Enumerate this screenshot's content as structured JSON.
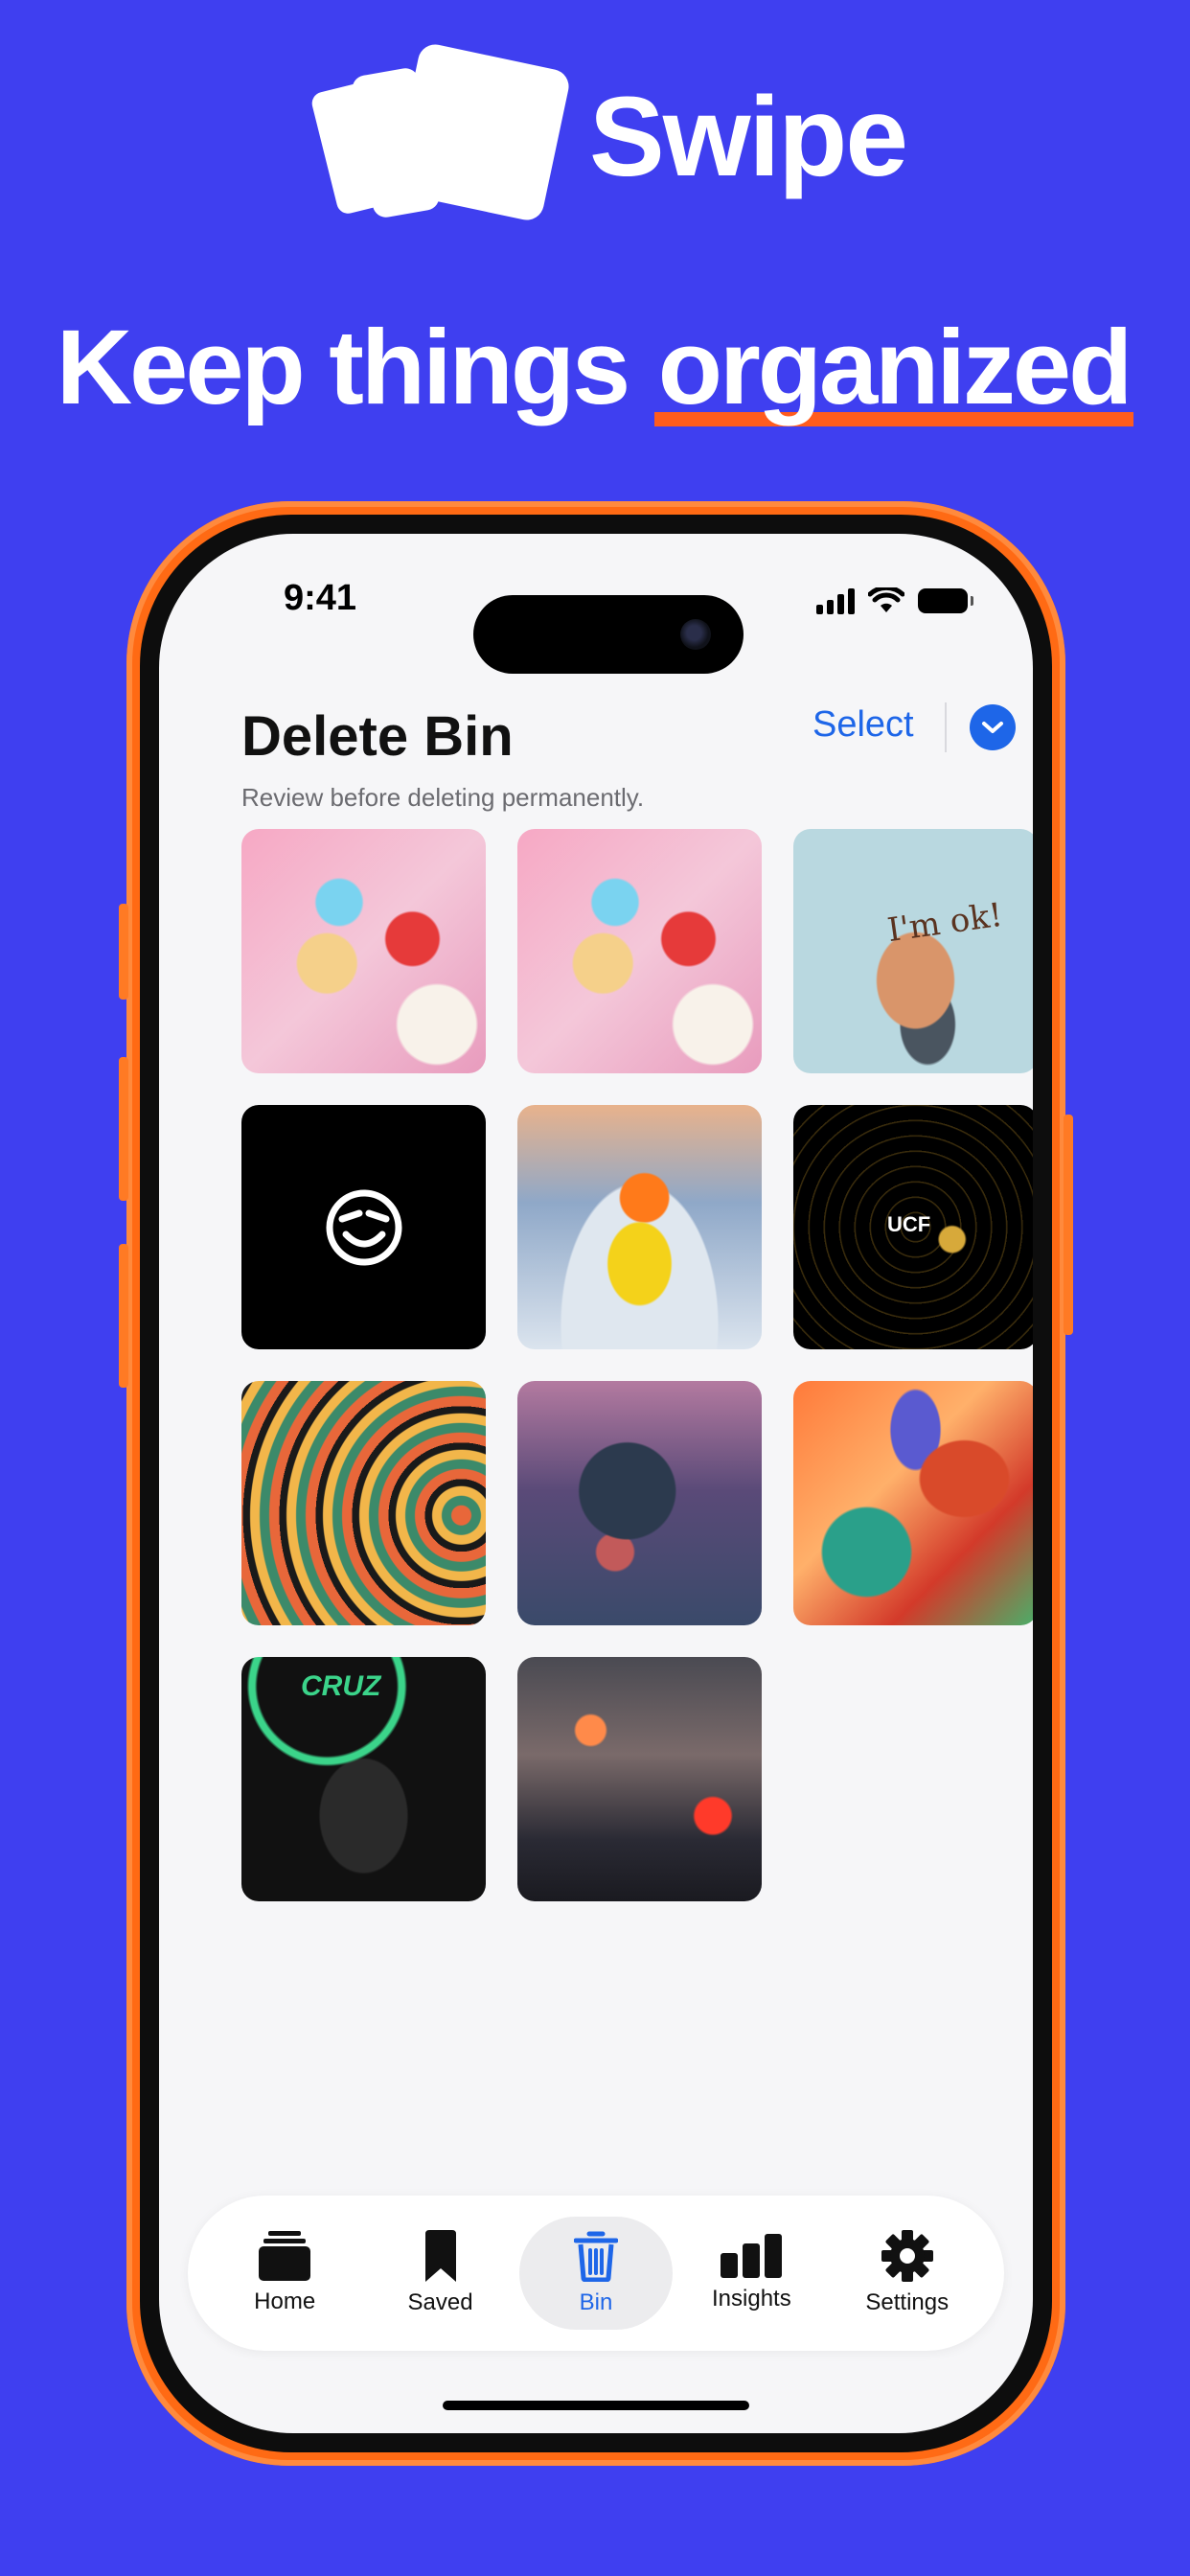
{
  "brand": {
    "name": "Swipe"
  },
  "headline": {
    "lead": "Keep things ",
    "highlight": "organized"
  },
  "status_bar": {
    "time": "9:41"
  },
  "screen": {
    "title": "Delete Bin",
    "subtitle": "Review before deleting permanently.",
    "select_label": "Select"
  },
  "thumbnails_text": {
    "cat_caption": "I'm ok!",
    "space_badge": "UCF",
    "cruz_text": "CRUZ"
  },
  "tabs": [
    {
      "label": "Home",
      "icon": "stack-icon"
    },
    {
      "label": "Saved",
      "icon": "bookmark-icon"
    },
    {
      "label": "Bin",
      "icon": "trash-icon",
      "active": true
    },
    {
      "label": "Insights",
      "icon": "bar-chart-icon"
    },
    {
      "label": "Settings",
      "icon": "gear-icon"
    }
  ],
  "colors": {
    "background": "#3f3ff0",
    "phone_frame": "#ff6a14",
    "accent": "#1e66e8",
    "highlight_underline": "#ff5c1e"
  }
}
